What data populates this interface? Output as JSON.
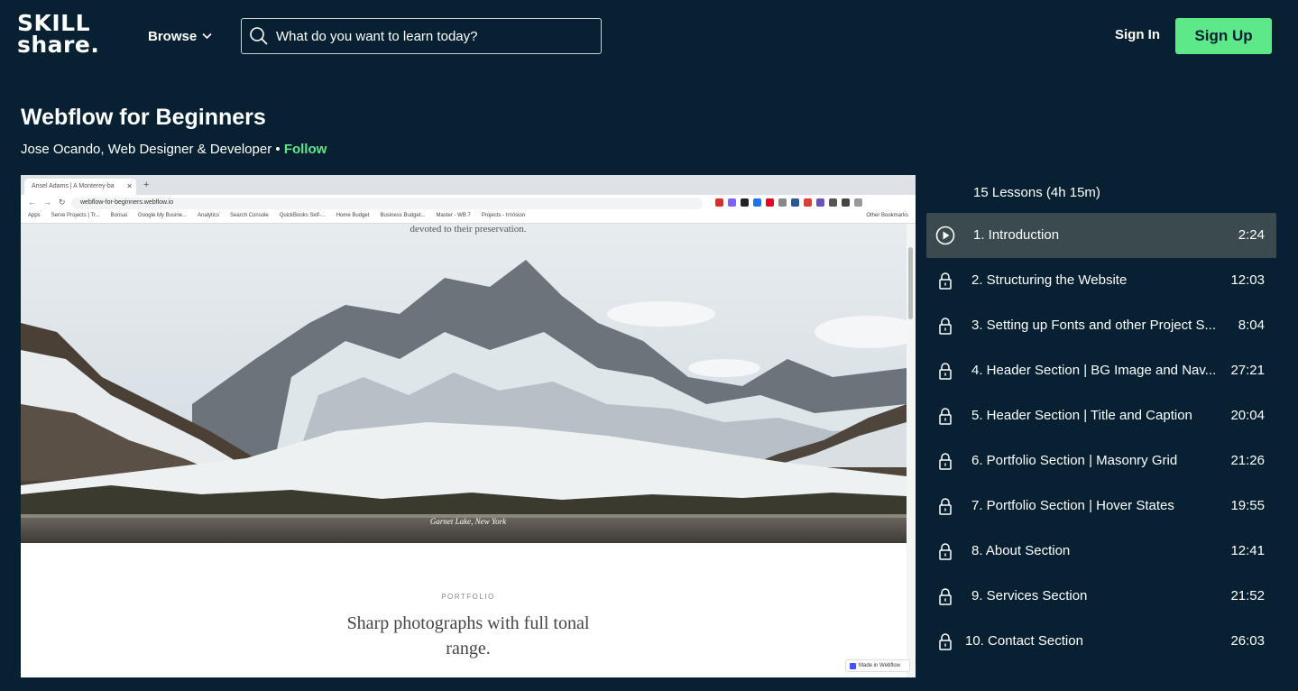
{
  "header": {
    "logo_line1": "SKILL",
    "logo_line2": "share.",
    "browse_label": "Browse",
    "search_placeholder": "What do you want to learn today?",
    "signin_label": "Sign In",
    "signup_label": "Sign Up",
    "accent_color": "#5de98a",
    "background_color": "#072133"
  },
  "course": {
    "title": "Webflow for Beginners",
    "instructor": "Jose Ocando, Web Designer & Developer",
    "separator": "•",
    "follow_label": "Follow"
  },
  "video": {
    "browser_tab_title": "Ansel Adams | A Monterey-ba",
    "browser_url": "webflow-for-beginners.webflow.io",
    "bookmarks": [
      "Apps",
      "Serve Projects | Tr...",
      "Bonsai",
      "Google My Busine...",
      "Analytics",
      "Search Console",
      "QuickBooks Self-...",
      "Home Budget",
      "Business Budget...",
      "Master - WB 7",
      "Projects - InVision"
    ],
    "other_bookmarks": "Other Bookmarks",
    "hero_top_caption": "devoted to their preservation.",
    "photo_caption": "Garnet Lake, New York",
    "section_label": "PORTFOLIO",
    "section_heading": "Sharp photographs with full tonal range.",
    "badge_label": "Made in Webflow"
  },
  "lessons": {
    "count_label": "15 Lessons (4h 15m)",
    "items": [
      {
        "label": "1. Introduction",
        "duration": "2:24",
        "icon": "play-icon",
        "active": true
      },
      {
        "label": "2. Structuring the Website",
        "duration": "12:03",
        "icon": "lock-icon"
      },
      {
        "label": "3. Setting up Fonts and other Project S...",
        "duration": "8:04",
        "icon": "lock-icon"
      },
      {
        "label": "4. Header Section | BG Image and Nav...",
        "duration": "27:21",
        "icon": "lock-icon"
      },
      {
        "label": "5. Header Section | Title and Caption",
        "duration": "20:04",
        "icon": "lock-icon"
      },
      {
        "label": "6. Portfolio Section | Masonry Grid",
        "duration": "21:26",
        "icon": "lock-icon"
      },
      {
        "label": "7. Portfolio Section | Hover States",
        "duration": "19:55",
        "icon": "lock-icon"
      },
      {
        "label": "8. About Section",
        "duration": "12:41",
        "icon": "lock-icon"
      },
      {
        "label": "9. Services Section",
        "duration": "21:52",
        "icon": "lock-icon"
      },
      {
        "label": "10. Contact Section",
        "duration": "26:03",
        "icon": "lock-icon"
      }
    ]
  }
}
